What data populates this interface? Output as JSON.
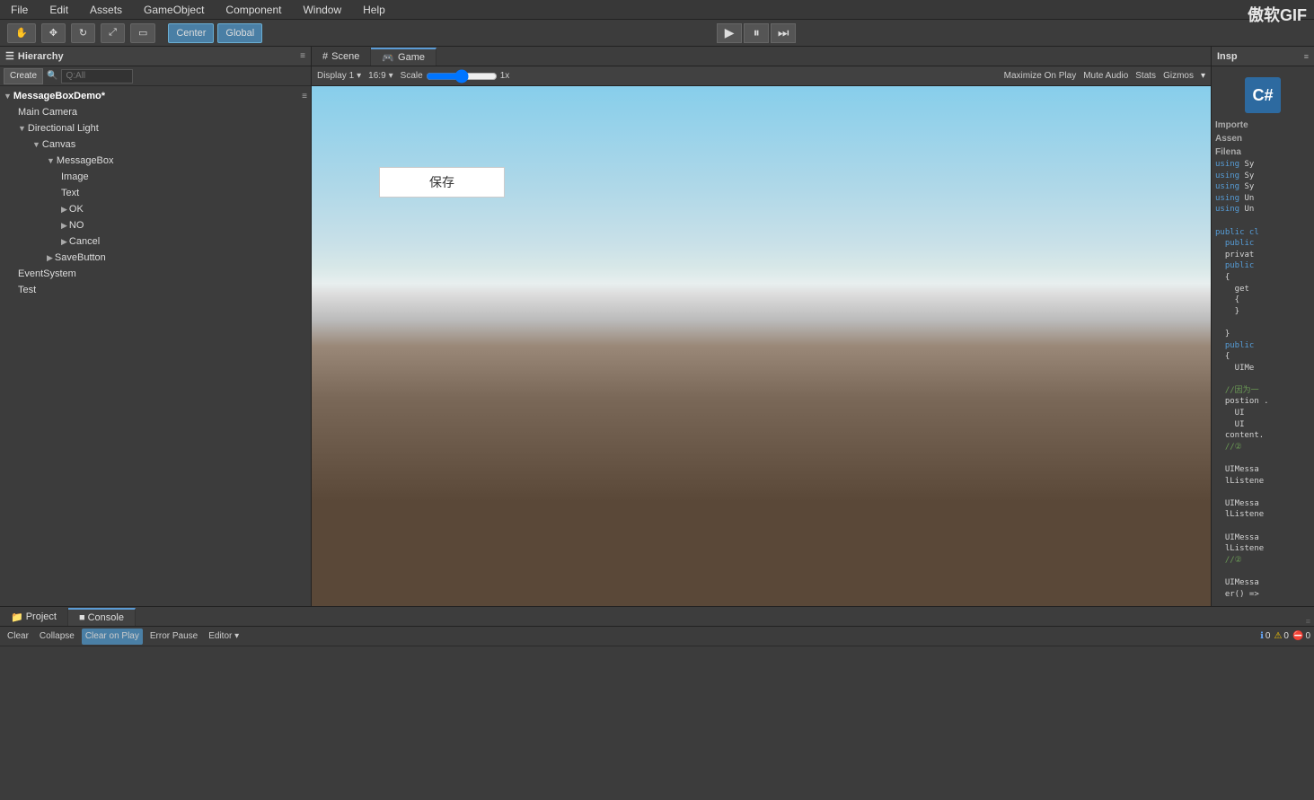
{
  "menuBar": {
    "items": [
      "File",
      "Edit",
      "Assets",
      "GameObject",
      "Component",
      "Window",
      "Help"
    ]
  },
  "toolbar": {
    "centerLabel": "Center",
    "globalLabel": "Global",
    "playBtn": "▶",
    "pauseBtn": "⏸",
    "stepBtn": "⏭",
    "watermark": "傲软GIF"
  },
  "hierarchy": {
    "title": "Hierarchy",
    "createLabel": "Create",
    "searchPlaceholder": "Q:All",
    "items": [
      {
        "id": "messageboxdemo",
        "label": "MessageBoxDemo*",
        "indent": 0,
        "expanded": true,
        "isRoot": true
      },
      {
        "id": "maincamera",
        "label": "Main Camera",
        "indent": 1,
        "expanded": false
      },
      {
        "id": "directionallight",
        "label": "Directional Light",
        "indent": 1,
        "expanded": true
      },
      {
        "id": "canvas",
        "label": "Canvas",
        "indent": 2,
        "expanded": true
      },
      {
        "id": "messagebox",
        "label": "MessageBox",
        "indent": 3,
        "expanded": true
      },
      {
        "id": "image",
        "label": "Image",
        "indent": 4,
        "expanded": false
      },
      {
        "id": "text",
        "label": "Text",
        "indent": 4,
        "expanded": false
      },
      {
        "id": "ok",
        "label": "OK",
        "indent": 4,
        "expanded": true
      },
      {
        "id": "no",
        "label": "NO",
        "indent": 4,
        "expanded": true
      },
      {
        "id": "cancel",
        "label": "Cancel",
        "indent": 4,
        "expanded": true
      },
      {
        "id": "savebutton",
        "label": "SaveButton",
        "indent": 3,
        "expanded": false
      },
      {
        "id": "eventsystem",
        "label": "EventSystem",
        "indent": 1,
        "expanded": false
      },
      {
        "id": "test",
        "label": "Test",
        "indent": 1,
        "expanded": false
      }
    ]
  },
  "sceneTabs": [
    {
      "id": "scene",
      "label": "Scene",
      "icon": "#",
      "active": false
    },
    {
      "id": "game",
      "label": "Game",
      "icon": "🎮",
      "active": true
    }
  ],
  "sceneControls": {
    "display": "Display 1",
    "ratio": "16:9",
    "scale": "Scale",
    "scaleValue": "1x",
    "maximizeLabel": "Maximize On Play",
    "muteLabel": "Mute Audio",
    "statsLabel": "Stats",
    "gizmosLabel": "Gizmos"
  },
  "gameView": {
    "buttonText": "保存"
  },
  "inspector": {
    "title": "Insp",
    "csIcon": "C#",
    "importedLabel": "Importe",
    "assemblyLabel": "Assen",
    "filenameLabel": "Filena",
    "codeLines": [
      "using Sy",
      "using Sy",
      "using Sy",
      "using Un",
      "using Un",
      "",
      "public cl",
      "  public",
      "  privat",
      "  public",
      "  {",
      "    get",
      "    {",
      "    }",
      "",
      "  }",
      "  public",
      "  {",
      "    UIMe",
      "",
      "  //因为一",
      "  postion .",
      "    UI",
      "    UI",
      "  content.",
      "  //②",
      "",
      "  UIMessа",
      "  lListene",
      "",
      "  UIMessа",
      "  lListene",
      "",
      "  UIMessа",
      "  lListene",
      "  //②",
      "",
      "  UIMessа",
      "  er() =>"
    ]
  },
  "bottomPanel": {
    "tabs": [
      {
        "id": "project",
        "label": "Project",
        "icon": "📁",
        "active": false
      },
      {
        "id": "console",
        "label": "Console",
        "icon": "■",
        "active": true
      }
    ],
    "toolbar": {
      "clearLabel": "Clear",
      "collapseLabel": "Collapse",
      "clearOnPlayLabel": "Clear on Play",
      "errorPauseLabel": "Error Pause",
      "editorLabel": "Editor ▾"
    },
    "logCounts": {
      "info": "0",
      "warning": "0",
      "error": "0"
    }
  }
}
